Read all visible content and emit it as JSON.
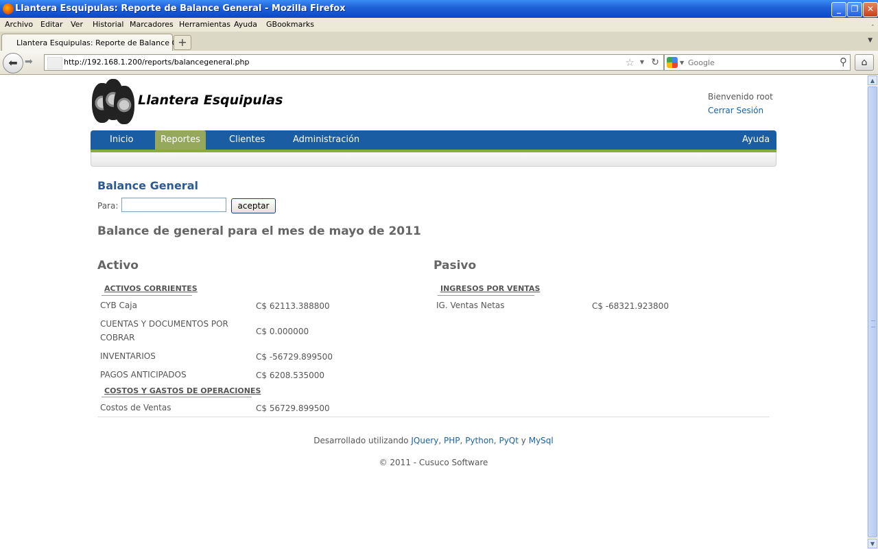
{
  "window": {
    "title": "Llantera Esquipulas: Reporte de Balance General - Mozilla Firefox"
  },
  "menu": [
    "Archivo",
    "Editar",
    "Ver",
    "Historial",
    "Marcadores",
    "Herramientas",
    "Ayuda",
    "GBookmarks"
  ],
  "tab": {
    "title": "Llantera Esquipulas: Reporte de Balance Ge...",
    "new_tab": "+"
  },
  "url": "http://192.168.1.200/reports/balancegeneral.php",
  "search": {
    "placeholder": "Google"
  },
  "site": {
    "title": "Llantera Esquipulas",
    "welcome": "Bienvenido root",
    "logout": "Cerrar Sesión"
  },
  "nav": {
    "inicio": "Inicio",
    "reportes": "Reportes",
    "clientes": "Clientes",
    "administracion": "Administración",
    "ayuda": "Ayuda"
  },
  "page": {
    "heading": "Balance General",
    "para_label": "Para:",
    "para_value": "",
    "accept": "aceptar",
    "report_title": "Balance de general para el mes de mayo de 2011"
  },
  "activo": {
    "heading": "Activo",
    "section1": "ACTIVOS CORRIENTES",
    "rows1": [
      {
        "name": "CYB Caja",
        "value": "C$ 62113.388800"
      },
      {
        "name": "CUENTAS Y DOCUMENTOS POR COBRAR",
        "value": "C$ 0.000000"
      },
      {
        "name": "INVENTARIOS",
        "value": "C$ -56729.899500"
      },
      {
        "name": "PAGOS ANTICIPADOS",
        "value": "C$ 6208.535000"
      }
    ],
    "section2": "COSTOS Y GASTOS DE OPERACIONES",
    "rows2": [
      {
        "name": "Costos de Ventas",
        "value": "C$ 56729.899500"
      }
    ]
  },
  "pasivo": {
    "heading": "Pasivo",
    "section1": "INGRESOS POR VENTAS",
    "rows1": [
      {
        "name": "IG. Ventas Netas",
        "value": "C$ -68321.923800"
      }
    ]
  },
  "footer": {
    "developed": "Desarrollado utilizando",
    "links": [
      "JQuery",
      "PHP",
      "Python",
      "PyQt",
      "MySql"
    ],
    "sep1": ",",
    "and": "y",
    "copyright": "© 2011 - Cusuco Software"
  }
}
